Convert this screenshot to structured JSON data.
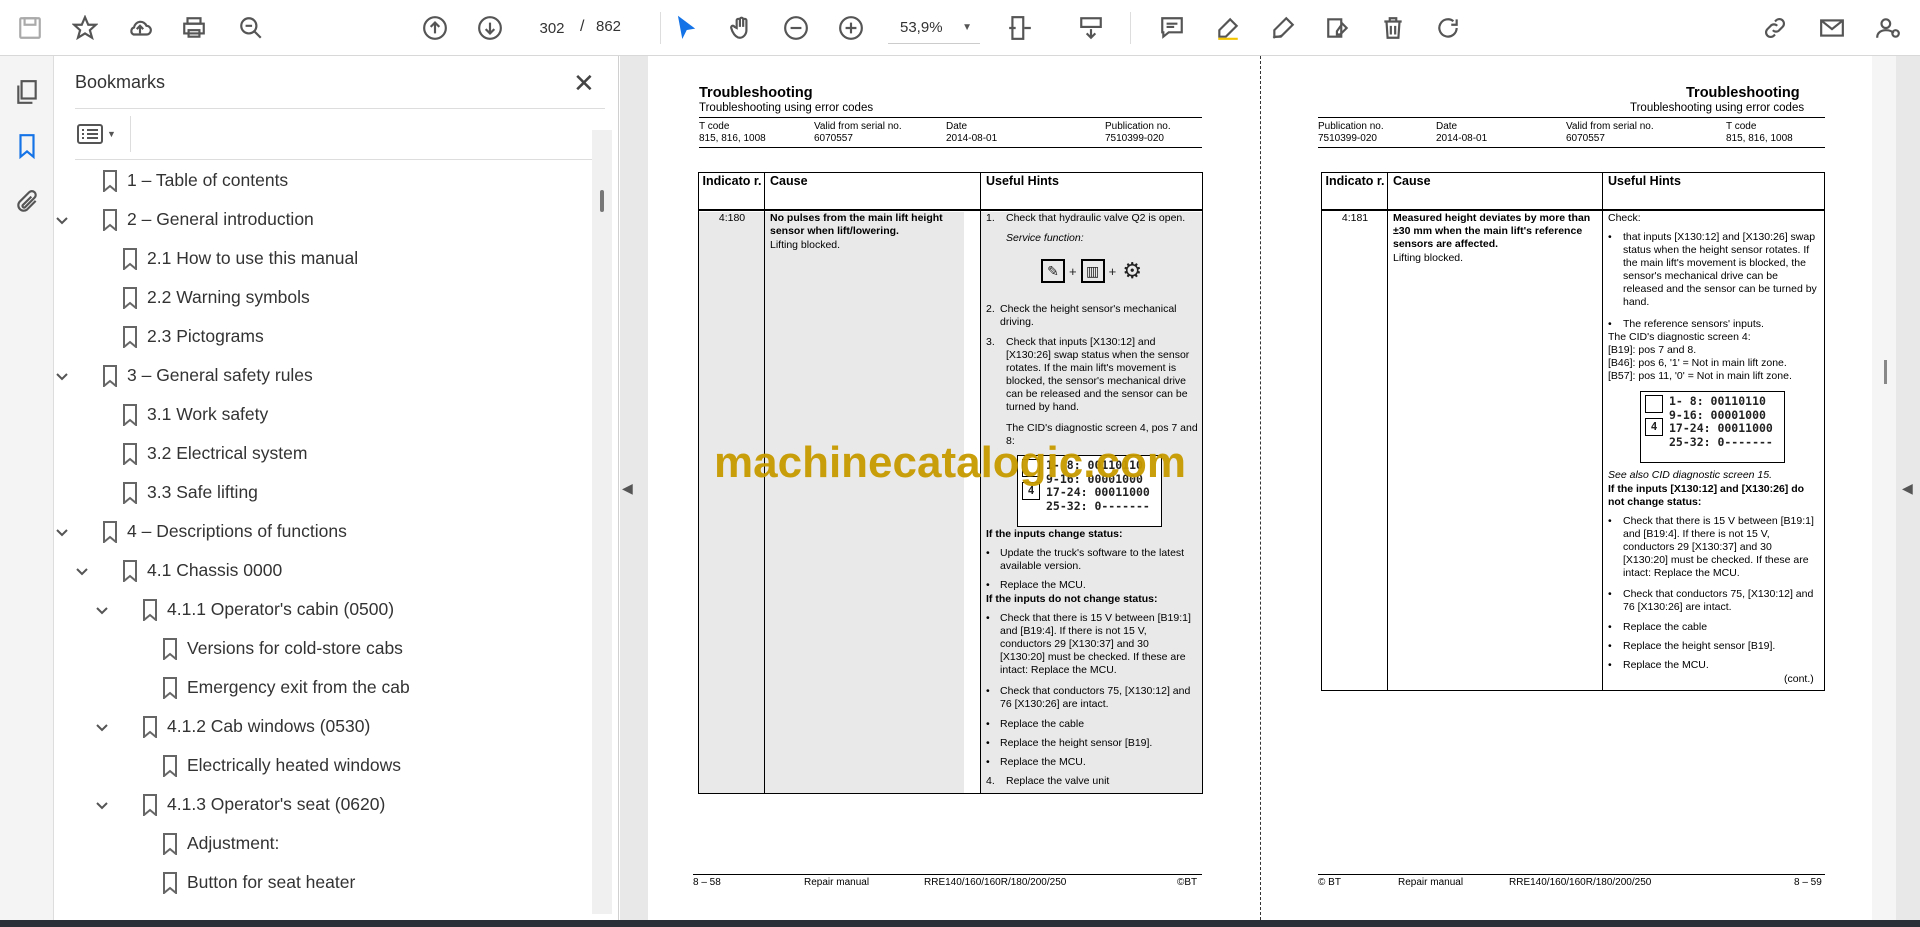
{
  "toolbar": {
    "page_current": "302",
    "page_separator": "/",
    "page_total": "862",
    "zoom": "53,9%"
  },
  "bookmarks_panel": {
    "title": "Bookmarks",
    "items": [
      {
        "label": "1 – Table of contents",
        "expanded": false
      },
      {
        "label": "2 – General introduction",
        "expanded": true
      },
      {
        "label": "2.1 How to use this manual"
      },
      {
        "label": "2.2 Warning symbols"
      },
      {
        "label": "2.3 Pictograms"
      },
      {
        "label": "3 – General safety rules",
        "expanded": true
      },
      {
        "label": "3.1 Work safety"
      },
      {
        "label": "3.2 Electrical system"
      },
      {
        "label": "3.3 Safe lifting"
      },
      {
        "label": "4 – Descriptions of functions",
        "expanded": true
      },
      {
        "label": "4.1 Chassis 0000",
        "expanded": true
      },
      {
        "label": "4.1.1 Operator's cabin (0500)",
        "expanded": true
      },
      {
        "label": "Versions for cold-store cabs"
      },
      {
        "label": "Emergency exit from the cab"
      },
      {
        "label": "4.1.2 Cab windows (0530)",
        "expanded": true
      },
      {
        "label": "Electrically heated windows"
      },
      {
        "label": "4.1.3 Operator's seat (0620)",
        "expanded": true
      },
      {
        "label": "Adjustment:"
      },
      {
        "label": "Button for seat heater"
      }
    ]
  },
  "left_page": {
    "title": "Troubleshooting",
    "subtitle": "Troubleshooting using error codes",
    "meta": [
      {
        "label": "T code",
        "value": "815, 816, 1008"
      },
      {
        "label": "Valid from serial no.",
        "value": "6070557"
      },
      {
        "label": "Date",
        "value": "2014-08-01"
      },
      {
        "label": "Publication no.",
        "value": "7510399-020"
      }
    ],
    "table_headers": [
      "Indicato r.",
      "Cause",
      "Useful Hints"
    ],
    "indicator": "4:180",
    "cause_bold": "No pulses from the main lift height sensor when lift/lowering.",
    "cause_text": "Lifting blocked.",
    "hints": {
      "h1_num": "1.",
      "h1": "Check that hydraulic valve Q2 is open.",
      "service_function": "Service function:",
      "h2_num": "2.",
      "h2": "Check the height sensor's mechanical driving.",
      "h3_num": "3.",
      "h3": "Check that inputs [X130:12] and [X130:26] swap status when the sensor rotates. If the main lift's movement is blocked, the sensor's mechanical drive can be released and the sensor can be turned by hand.",
      "cid_note": "The CID's diagnostic screen 4, pos 7 and 8:",
      "if_change": "If the inputs change status:",
      "b1": "Update the truck's software to the latest available version.",
      "b2": "Replace the MCU.",
      "if_not_change": "If the inputs do not change status:",
      "b3": "Check that there is 15 V between [B19:1] and [B19:4]. If there is not 15 V, conductors 29 [X130:37] and 30 [X130:20] must be checked. If these are intact: Replace the MCU.",
      "b4": "Check that conductors 75, [X130:12] and 76 [X130:26] are intact.",
      "b5": "Replace the cable",
      "b6": "Replace the height sensor [B19].",
      "b7": "Replace the MCU.",
      "h4_num": "4.",
      "h4": "Replace the valve unit"
    },
    "diag_rows": [
      "1- 8: 00110110",
      "9-16: 00001000",
      "17-24: 00011000",
      "25-32: 0-------"
    ],
    "footer": {
      "page": "8 – 58",
      "doc": "Repair manual",
      "model": "RRE140/160/160R/180/200/250",
      "copy": "©BT"
    }
  },
  "right_page": {
    "title": "Troubleshooting",
    "subtitle": "Troubleshooting using error codes",
    "meta": [
      {
        "label": "Publication no.",
        "value": "7510399-020"
      },
      {
        "label": "Date",
        "value": "2014-08-01"
      },
      {
        "label": "Valid from serial no.",
        "value": "6070557"
      },
      {
        "label": "T code",
        "value": "815, 816, 1008"
      }
    ],
    "table_headers": [
      "Indicato r.",
      "Cause",
      "Useful Hints"
    ],
    "indicator": "4:181",
    "cause_bold": "Measured height deviates by more than ±30 mm when the main lift's reference sensors are affected.",
    "cause_text": "Lifting blocked.",
    "hints": {
      "check": "Check:",
      "c1": "that inputs [X130:12] and [X130:26] swap status when the height sensor rotates. If the main lift's movement is blocked, the sensor's mechanical drive can be released and the sensor can be turned by hand.",
      "c2": "The reference sensors' inputs.",
      "cid": "The CID's diagnostic screen 4:",
      "b19": "[B19]: pos 7 and 8.",
      "b46": "[B46]: pos 6, '1' = Not in main lift zone.",
      "b57": "[B57]: pos 11, '0' = Not in main lift zone.",
      "see_also": "See also CID diagnostic screen 15.",
      "if_not": "If the inputs [X130:12] and [X130:26] do not change status:",
      "d1": "Check that there is 15 V between [B19:1] and [B19:4]. If there is not 15 V, conductors 29 [X130:37] and 30 [X130:20] must be checked. If these are intact: Replace the MCU.",
      "d2": "Check that conductors 75, [X130:12] and 76 [X130:26] are intact.",
      "d3": "Replace the cable",
      "d4": "Replace the height sensor [B19].",
      "d5": "Replace the MCU.",
      "cont": "(cont.)"
    },
    "diag_rows": [
      "1- 8: 00110110",
      "9-16: 00001000",
      "17-24: 00011000",
      "25-32: 0-------"
    ],
    "footer": {
      "copy": "© BT",
      "doc": "Repair manual",
      "model": "RRE140/160/160R/180/200/250",
      "page": "8 – 59"
    }
  },
  "watermark": "machinecatalogic.com"
}
